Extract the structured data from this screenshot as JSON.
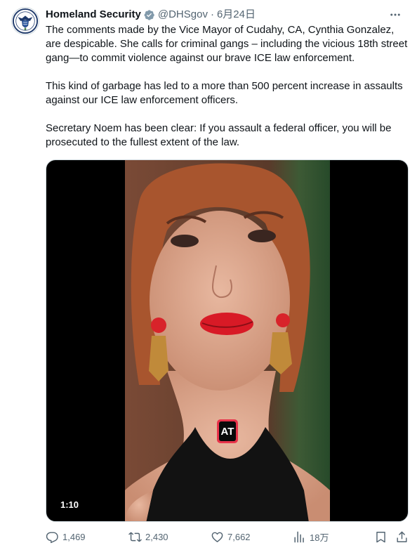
{
  "author": {
    "display_name": "Homeland Security",
    "handle": "@DHSgov",
    "separator": "·",
    "date": "6月24日",
    "verified": true,
    "verified_color": "#829aab"
  },
  "tweet": {
    "paragraphs": [
      "The comments made by the Vice Mayor of Cudahy, CA, Cynthia Gonzalez, are despicable. She calls for criminal gangs – including the vicious 18th street gang—to commit violence against our brave ICE law enforcement.",
      "This kind of garbage has led to a more than 500 percent increase in assaults against our ICE law enforcement officers.",
      "Secretary Noem has been clear: If you assault a federal officer, you will be prosecuted to the fullest extent of the law."
    ]
  },
  "media": {
    "type": "video",
    "duration": "1:10",
    "watermark": "AT"
  },
  "actions": {
    "replies": "1,469",
    "reposts": "2,430",
    "likes": "7,662",
    "views": "18万"
  },
  "icons": {
    "more": "more-horizontal-icon",
    "reply": "reply-bubble-icon",
    "repost": "repost-arrows-icon",
    "like": "heart-icon",
    "views": "views-bar-chart-icon",
    "bookmark": "bookmark-icon",
    "share": "share-upload-icon"
  },
  "colors": {
    "text": "#0f1419",
    "secondary": "#536471",
    "border": "#cfd9de"
  }
}
